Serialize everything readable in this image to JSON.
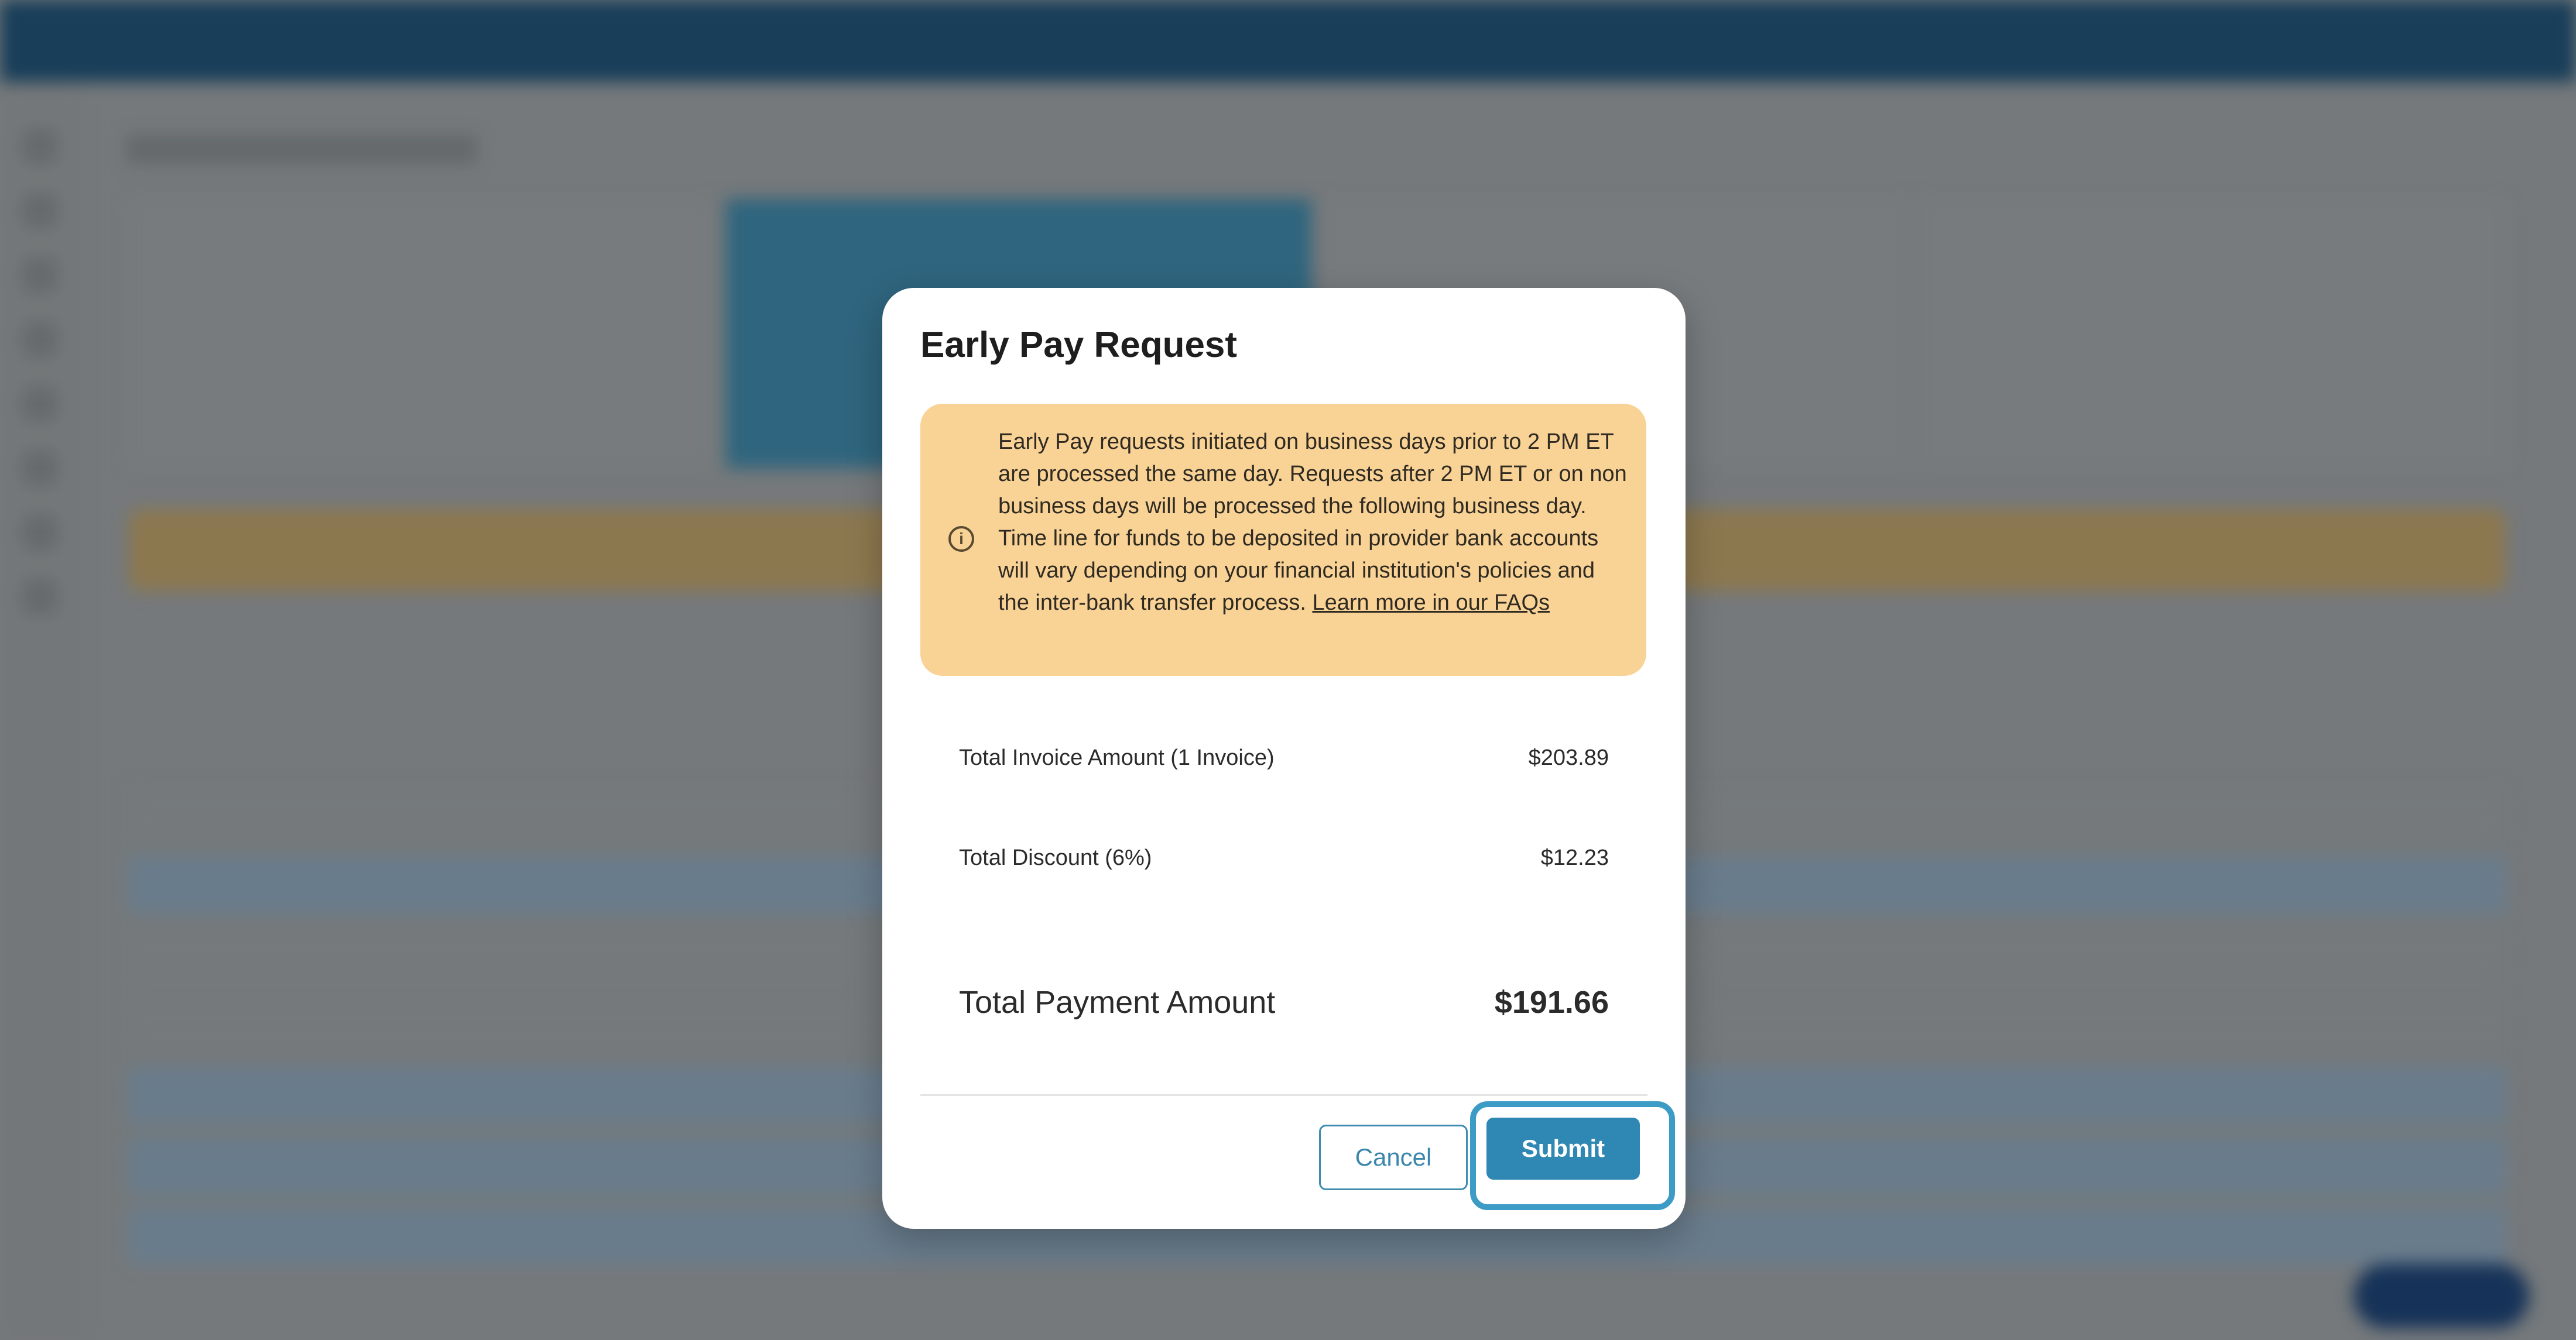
{
  "modal": {
    "title": "Early Pay Request",
    "notice": {
      "text": "Early Pay requests initiated on business days prior to 2 PM ET are processed the same day. Requests after 2 PM ET or on non business days will be processed the following business day. Time line for funds to be deposited in provider bank accounts will vary depending on your financial institution's policies and the inter-bank transfer process.",
      "link": "Learn more in our FAQs"
    },
    "summary": {
      "invoice_label": "Total Invoice Amount (1 Invoice)",
      "invoice_value": "$203.89",
      "discount_label": "Total Discount (6%)",
      "discount_value": "$12.23",
      "payment_label": "Total Payment Amount",
      "payment_value": "$191.66"
    },
    "buttons": {
      "cancel": "Cancel",
      "submit": "Submit"
    }
  },
  "colors": {
    "header": "#0f3b5c",
    "notice_bg": "#f9d396",
    "primary": "#2f87b4",
    "focus_ring": "#3d9cc6"
  }
}
